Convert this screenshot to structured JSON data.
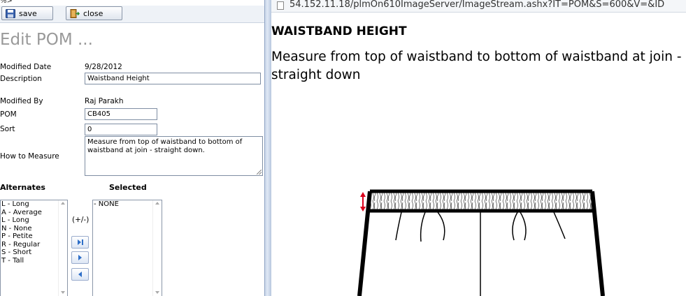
{
  "left": {
    "top_text": "%>",
    "toolbar": {
      "save_label": "save",
      "close_label": "close"
    },
    "page_title": "Edit POM ...",
    "form": {
      "modified_date_label": "Modified Date",
      "modified_date_value": "9/28/2012",
      "description_label": "Description",
      "description_value": "Waistband Height",
      "modified_by_label": "Modified By",
      "modified_by_value": "Raj Parakh",
      "pom_label": "POM",
      "pom_value": "CB405",
      "sort_label": "Sort",
      "sort_value": "0",
      "how_to_measure_label": "How to Measure",
      "how_to_measure_value": "Measure from top of waistband to bottom of waistband at join - straight down."
    },
    "alternates": {
      "header": "Alternates",
      "items": [
        "L - Long",
        "A - Average",
        "L - Long",
        "N - None",
        "P - Petite",
        "R - Regular",
        "S - Short",
        "T - Tall"
      ]
    },
    "plus_minus_label": "(+/-)",
    "selected": {
      "header": "Selected",
      "items": [
        "- NONE"
      ]
    }
  },
  "right": {
    "address": "54.152.11.18/plmOn610ImageServer/ImageStream.ashx?IT=POM&S=600&V=&ID",
    "pom_title": "WAISTBAND HEIGHT",
    "pom_description": "Measure from top of waistband to bottom of waistband at join - straight down",
    "accent_color": "#d9001b"
  },
  "icons": {
    "save": "floppy-disk-icon",
    "close": "exit-door-icon",
    "page": "document-icon"
  }
}
